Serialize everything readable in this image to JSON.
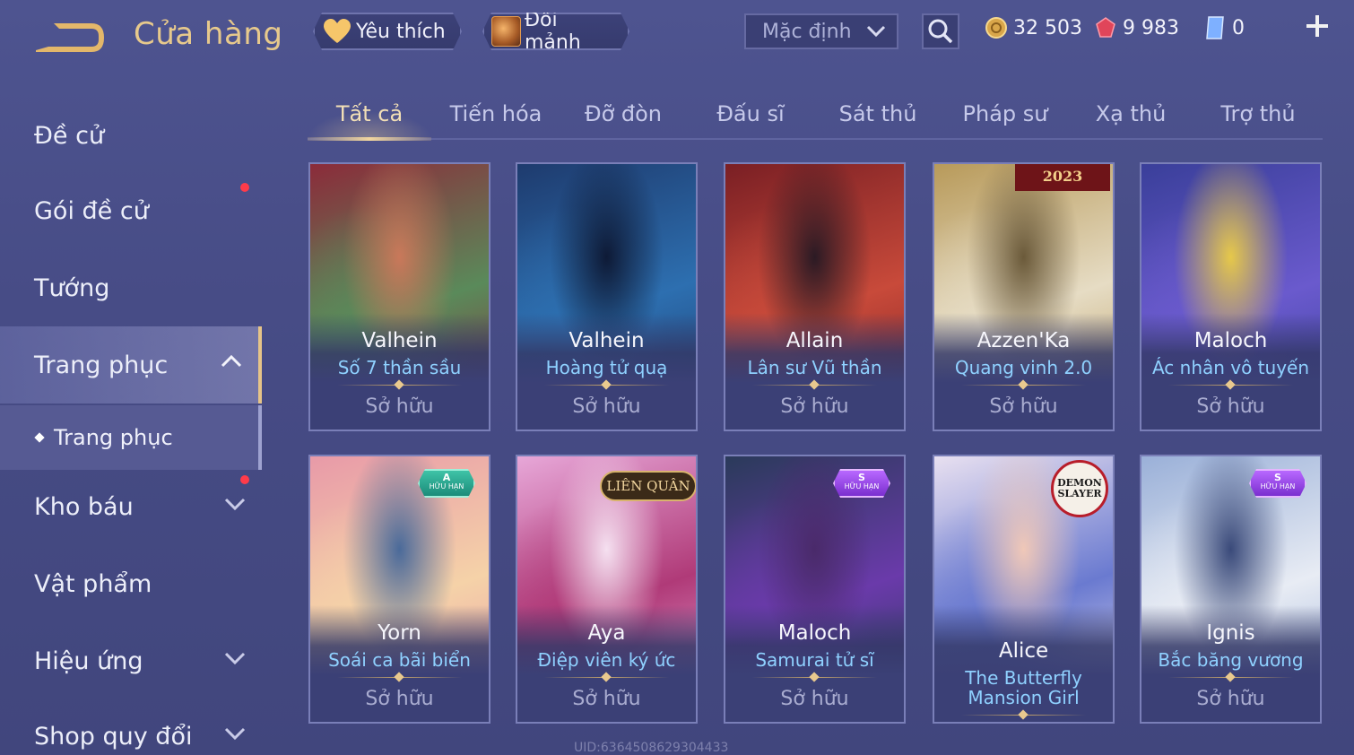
{
  "header": {
    "title": "Cửa hàng",
    "favorites_label": "Yêu thích",
    "exchange_label": "Đổi mảnh",
    "sort_value": "Mặc định",
    "currencies": {
      "gold": "32 503",
      "gems": "9 983",
      "tickets": "0"
    }
  },
  "sidebar": {
    "items": [
      {
        "label": "Đề cử"
      },
      {
        "label": "Gói đề cử"
      },
      {
        "label": "Tướng"
      },
      {
        "label": "Trang phục"
      },
      {
        "label": "Trang phục"
      },
      {
        "label": "Kho báu"
      },
      {
        "label": "Vật phẩm"
      },
      {
        "label": "Hiệu ứng"
      },
      {
        "label": "Shop quy đổi"
      }
    ]
  },
  "tabs": [
    "Tất cả",
    "Tiến hóa",
    "Đỡ đòn",
    "Đấu sĩ",
    "Sát thủ",
    "Pháp sư",
    "Xạ thủ",
    "Trợ thủ"
  ],
  "cards": [
    {
      "hero": "Valhein",
      "skin": "Số 7 thần sầu",
      "status": "Sở hữu",
      "art": [
        "#8b2b3a",
        "#5a8a5a",
        "#c9785a"
      ]
    },
    {
      "hero": "Valhein",
      "skin": "Hoàng tử quạ",
      "status": "Sở hữu",
      "art": [
        "#1e3b6e",
        "#2d6fb0",
        "#0e1a36"
      ]
    },
    {
      "hero": "Allain",
      "skin": "Lân sư Vũ thần",
      "status": "Sở hữu",
      "art": [
        "#7a1f24",
        "#c84a3a",
        "#2b1a24"
      ]
    },
    {
      "hero": "Azzen'Ka",
      "skin": "Quang vinh 2.0",
      "status": "Sở hữu",
      "art": [
        "#b89a5a",
        "#e6dcc4",
        "#6b5a3a"
      ]
    },
    {
      "hero": "Maloch",
      "skin": "Ác nhân vô tuyến",
      "status": "Sở hữu",
      "art": [
        "#3a3f9a",
        "#6a5acd",
        "#e6c84a"
      ]
    },
    {
      "hero": "Yorn",
      "skin": "Soái ca bãi biển",
      "status": "Sở hữu",
      "art": [
        "#e89aa8",
        "#f5d2a8",
        "#4a6a9a"
      ]
    },
    {
      "hero": "Aya",
      "skin": "Điệp viên ký ức",
      "status": "Sở hữu",
      "art": [
        "#e7a7d8",
        "#b03a78",
        "#f5e0f0"
      ]
    },
    {
      "hero": "Maloch",
      "skin": "Samurai tử sĩ",
      "status": "Sở hữu",
      "art": [
        "#2a3a5a",
        "#6a3aaa",
        "#4a2a6a"
      ]
    },
    {
      "hero": "Alice",
      "skin": "The Butterfly Mansion Girl",
      "status": "Sở hữu",
      "art": [
        "#e8e0f0",
        "#6a7ad0",
        "#f0c8b8"
      ]
    },
    {
      "hero": "Ignis",
      "skin": "Bắc băng vương",
      "status": "Sở hữu",
      "art": [
        "#9ab0d8",
        "#e8ecf4",
        "#3a4a7a"
      ]
    }
  ],
  "badges": {
    "a_grade": "A",
    "s_grade": "S",
    "limited": "HỮU HẠN",
    "ranking_year": "2023",
    "lienquan": "LIÊN QUÂN",
    "demon_slayer": "DEMON SLAYER"
  },
  "uid": "UID:6364508629304433"
}
